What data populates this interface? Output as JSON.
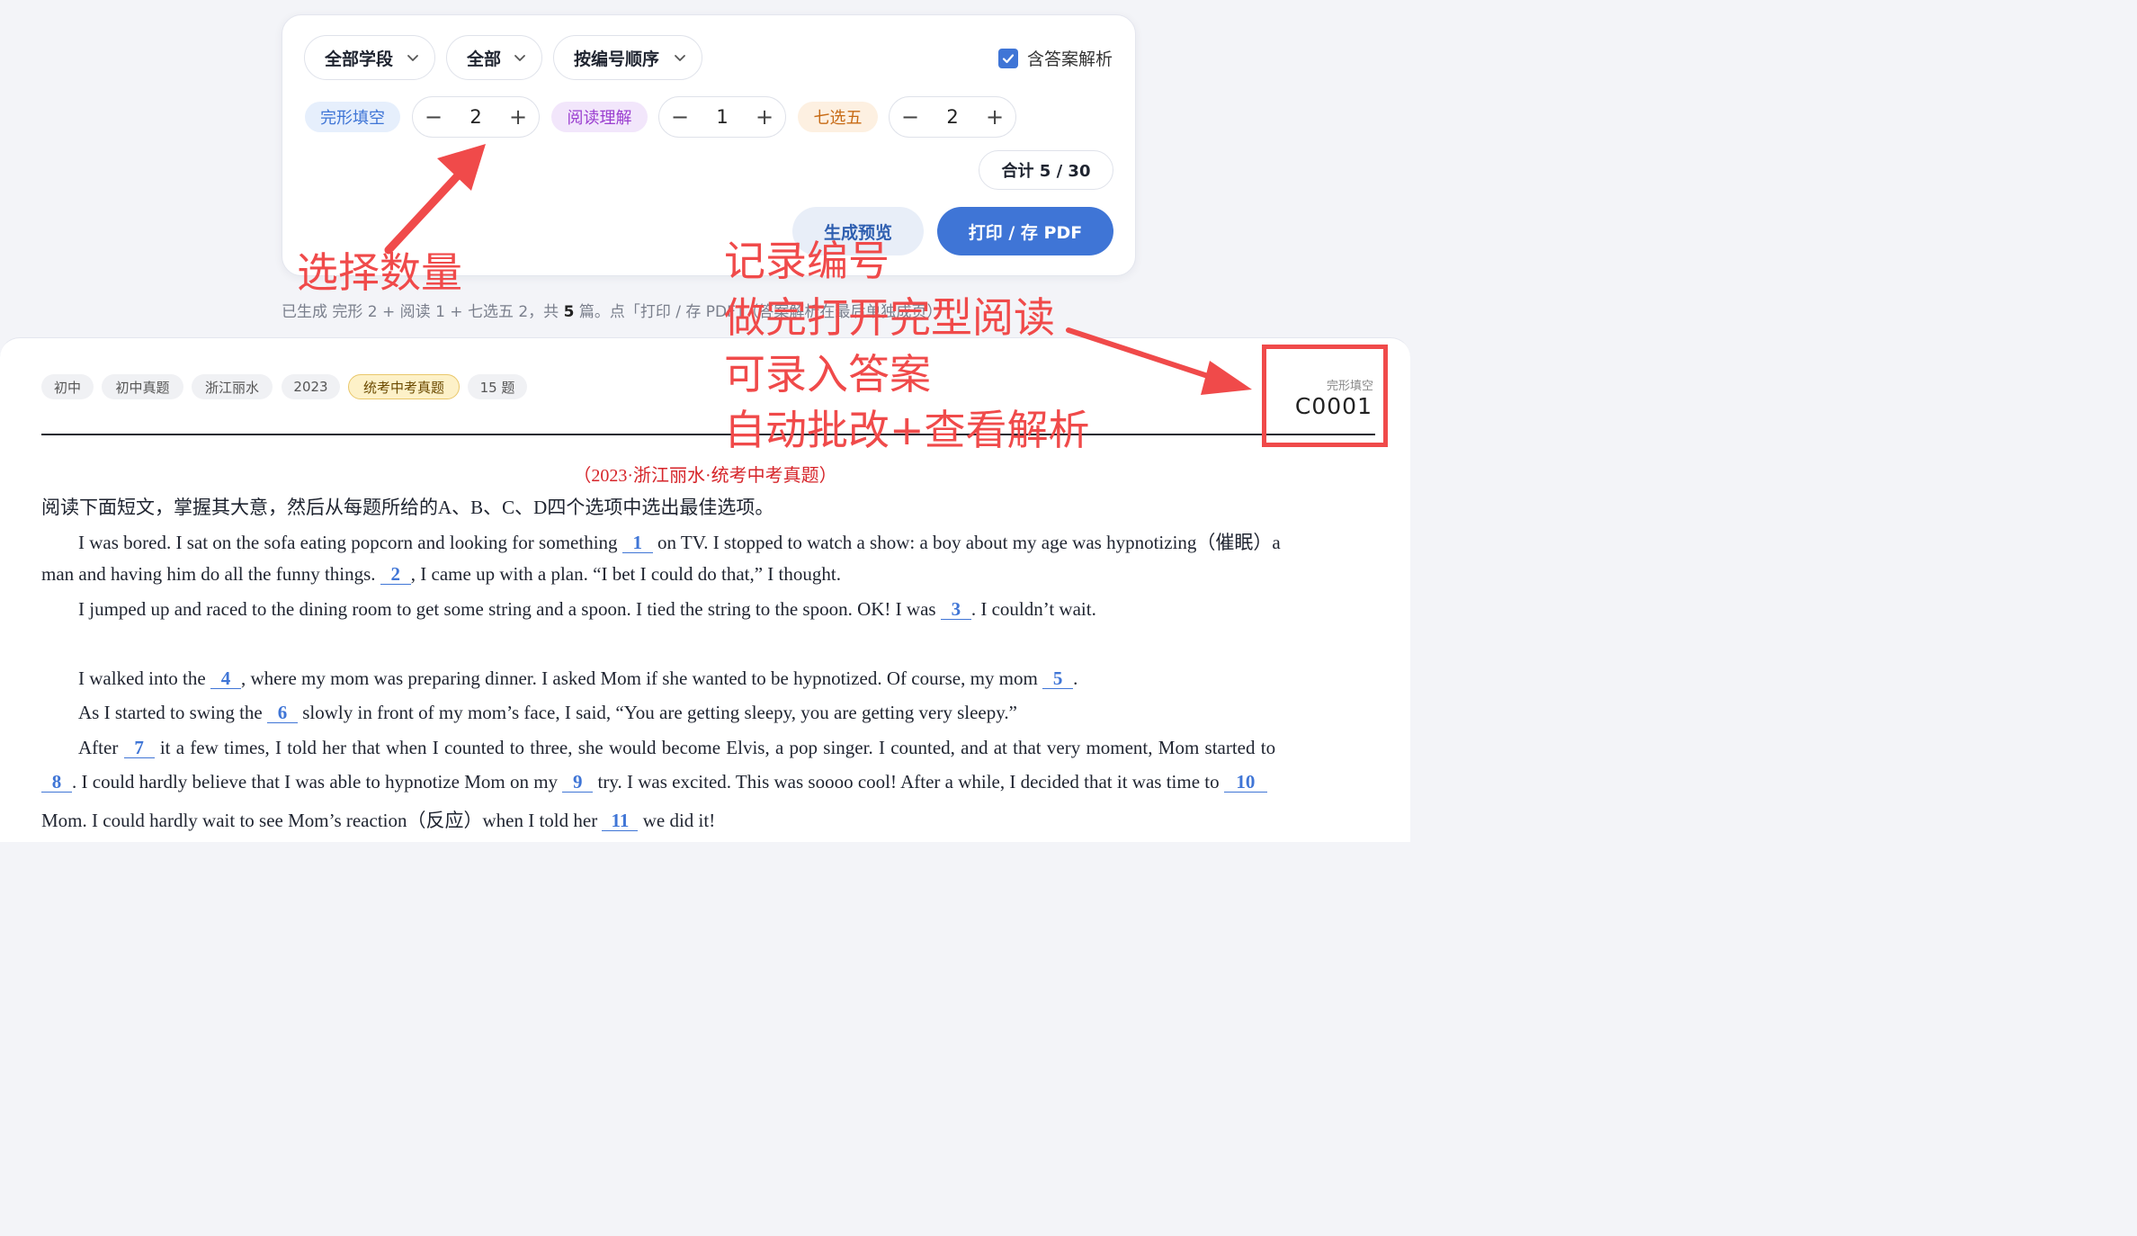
{
  "filters": {
    "stage": "全部学段",
    "scope": "全部",
    "order": "按编号顺序",
    "include_answers_label": "含答案解析",
    "include_answers_checked": true
  },
  "types": [
    {
      "label": "完形填空",
      "count": "2"
    },
    {
      "label": "阅读理解",
      "count": "1"
    },
    {
      "label": "七选五",
      "count": "2"
    }
  ],
  "total": "合计 5 / 30",
  "buttons": {
    "preview": "生成预览",
    "print": "打印 / 存 PDF"
  },
  "status_line": {
    "text_before": "已生成 完形 2 + 阅读 1 + 七选五 2，共",
    "count": "5",
    "text_after": "篇。点「打印 / 存 PDF」（答案解析在最后单独成页）"
  },
  "document": {
    "tags": [
      "初中",
      "初中真题",
      "浙江丽水",
      "2023",
      "统考中考真题",
      "15 题"
    ],
    "type_label": "完形填空",
    "code": "C0001",
    "source": "（2023·浙江丽水·统考中考真题）",
    "instruction": "阅读下面短文，掌握其大意，然后从每题所给的A、B、C、D四个选项中选出最佳选项。",
    "p1_a": "I was bored. I sat on the sofa eating popcorn and looking for something",
    "b1": "1",
    "p1_b": "on TV. I stopped to watch a show: a boy about my age was hypnotizing（催眠）a",
    "p1_c": "man and having him do all the funny things.",
    "b2": "2",
    "p1_d": ", I came up with a plan. “I bet I could do that,” I thought.",
    "p2_a": "I jumped up and raced to the dining room to get some string and a spoon. I tied the string to the spoon. OK! I was",
    "b3": "3",
    "p2_b": ". I couldn’t wait.",
    "p3_a": "I walked into the",
    "b4": "4",
    "p3_b": ", where my mom was preparing dinner. I asked Mom if she wanted to be hypnotized. Of course, my mom",
    "b5": "5",
    "p3_c": ".",
    "p4_a": "As I started to swing the",
    "b6": "6",
    "p4_b": "slowly in front of my mom’s face, I said, “You are getting sleepy, you are getting very sleepy.”",
    "p5_a": "After",
    "b7": "7",
    "p5_b": "it a few times, I told her that when I counted to three, she would become Elvis, a pop singer. I counted, and at that very moment, Mom started to",
    "b8": "8",
    "p5_c": ". I could hardly believe that I was able to hypnotize Mom on my",
    "b9": "9",
    "p5_d": "try. I was excited. This was soooo cool! After a while, I decided that it was time to",
    "b10": "10",
    "p6_a": "Mom. I could hardly wait to see Mom’s reaction（反应）when I told her",
    "b11": "11",
    "p6_b": "we did it!"
  },
  "annotations": {
    "choose_count": "选择数量",
    "record_code": "记录编号",
    "after_done": "做完打开完型阅读",
    "enter_answers": "可录入答案",
    "auto_grade": "自动批改+查看解析"
  },
  "colors": {
    "accent": "#3f75d6",
    "annotation": "#f04a4a",
    "source_red": "#d6252a"
  }
}
